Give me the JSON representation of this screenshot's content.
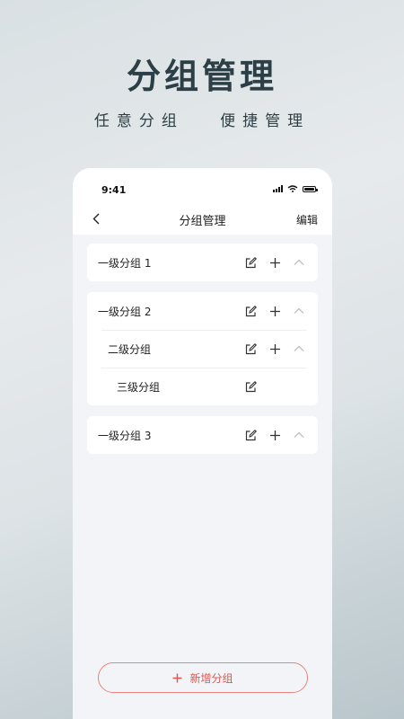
{
  "promo": {
    "title": "分组管理",
    "subtitle": "任意分组   便捷管理"
  },
  "status_bar": {
    "time": "9:41"
  },
  "nav": {
    "title": "分组管理",
    "edit_label": "编辑"
  },
  "groups": [
    {
      "label": "一级分组 1"
    },
    {
      "label": "一级分组 2"
    },
    {
      "label": "二级分组"
    },
    {
      "label": "三级分组"
    },
    {
      "label": "一级分组 3"
    }
  ],
  "add_group": {
    "label": "新增分组"
  },
  "colors": {
    "accent": "#e0564f",
    "title_text": "#2c3e46",
    "card_bg": "#ffffff",
    "page_bg": "#f3f4f7"
  }
}
